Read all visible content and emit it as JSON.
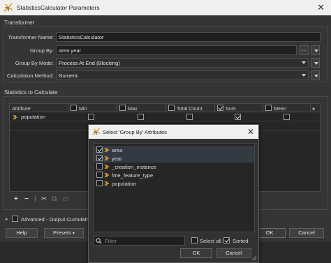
{
  "window": {
    "title": "StatisticsCalculator Parameters"
  },
  "transformer": {
    "section_label": "Transformer",
    "name_label": "Transformer Name:",
    "name_value": "StatisticsCalculator",
    "groupby_label": "Group By:",
    "groupby_value": "area year",
    "groupby_browse": "...",
    "groupby_mode_label": "Group By Mode:",
    "groupby_mode_value": "Process At End (Blocking)",
    "calc_method_label": "Calculation Method:",
    "calc_method_value": "Numeric"
  },
  "stats": {
    "section_label": "Statistics to Calculate",
    "columns": [
      {
        "label": "Attribute",
        "checked": null
      },
      {
        "label": "Min",
        "checked": false
      },
      {
        "label": "Max",
        "checked": false
      },
      {
        "label": "Total Count",
        "checked": false
      },
      {
        "label": "Sum",
        "checked": true
      },
      {
        "label": "Mean",
        "checked": false
      }
    ],
    "more_columns_icon": "double-chevron-right-icon",
    "rows": [
      {
        "attribute": "population",
        "min": false,
        "max": false,
        "total_count": false,
        "sum": true,
        "mean": false
      }
    ]
  },
  "toolbar": {
    "icons": [
      "add-icon",
      "remove-icon",
      "separator",
      "cut-icon",
      "copy-icon",
      "paste-icon"
    ]
  },
  "advanced": {
    "label": "Advanced - Output Cumulative"
  },
  "footer": {
    "help_label": "Help",
    "presets_label": "Presets",
    "ok_label": "OK",
    "cancel_label": "Cancel"
  },
  "modal": {
    "title": "Select 'Group By' Attributes",
    "items": [
      {
        "label": "area",
        "checked": true,
        "selected": true
      },
      {
        "label": "year",
        "checked": true,
        "selected": true
      },
      {
        "label": "_creation_instance",
        "checked": false,
        "selected": false
      },
      {
        "label": "fme_feature_type",
        "checked": false,
        "selected": false
      },
      {
        "label": "population",
        "checked": false,
        "selected": false
      }
    ],
    "filter_placeholder": "Filter",
    "select_all_label": "Select all",
    "select_all_checked": false,
    "sorted_label": "Sorted",
    "sorted_checked": true,
    "ok_label": "OK",
    "cancel_label": "Cancel"
  },
  "colors": {
    "window_bg": "#353535",
    "titlebar_bg": "#f0f0f0",
    "field_bg": "#1f1f1f",
    "accent_attr_icon": "#d99a3a"
  }
}
